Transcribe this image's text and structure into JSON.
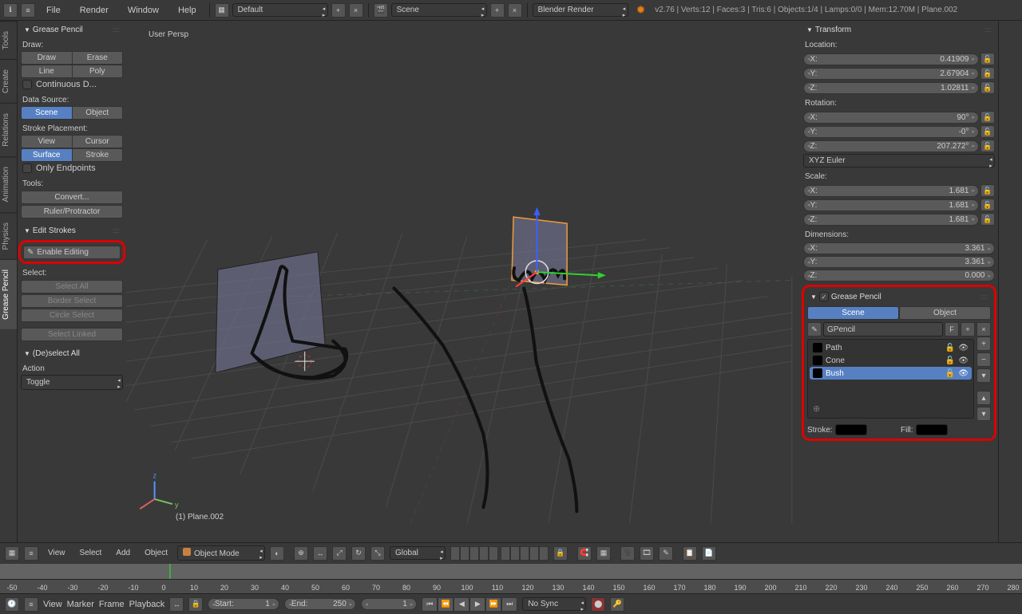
{
  "topbar": {
    "menus": [
      "File",
      "Render",
      "Window",
      "Help"
    ],
    "layout": "Default",
    "scene": "Scene",
    "engine": "Blender Render",
    "stats": "v2.76 | Verts:12 | Faces:3 | Tris:6 | Objects:1/4 | Lamps:0/0 | Mem:12.70M | Plane.002"
  },
  "sidetabs": [
    "Tools",
    "Create",
    "Relations",
    "Animation",
    "Physics",
    "Grease Pencil"
  ],
  "toolpanel": {
    "gp_header": "Grease Pencil",
    "draw_label": "Draw:",
    "draw": "Draw",
    "erase": "Erase",
    "line": "Line",
    "poly": "Poly",
    "continuous": "Continuous D...",
    "datasource_label": "Data Source:",
    "ds_scene": "Scene",
    "ds_object": "Object",
    "strokeplace_label": "Stroke Placement:",
    "sp_view": "View",
    "sp_cursor": "Cursor",
    "sp_surface": "Surface",
    "sp_stroke": "Stroke",
    "only_endpoints": "Only Endpoints",
    "tools_label": "Tools:",
    "convert": "Convert...",
    "ruler": "Ruler/Protractor",
    "edit_strokes_header": "Edit Strokes",
    "enable_editing": "Enable Editing",
    "select_label": "Select:",
    "select_all": "Select All",
    "border_select": "Border Select",
    "circle_select": "Circle Select",
    "select_linked": "Select Linked",
    "deselect_header": "(De)select All",
    "action_label": "Action",
    "toggle": "Toggle"
  },
  "viewport": {
    "persp": "User Persp",
    "obj_label": "(1) Plane.002"
  },
  "props": {
    "transform_header": "Transform",
    "location_label": "Location:",
    "loc": {
      "x": "0.41909",
      "y": "2.67904",
      "z": "1.02811"
    },
    "rotation_label": "Rotation:",
    "rot": {
      "x": "90°",
      "y": "-0°",
      "z": "207.272°"
    },
    "rot_mode": "XYZ Euler",
    "scale_label": "Scale:",
    "scale": {
      "x": "1.681",
      "y": "1.681",
      "z": "1.681"
    },
    "dim_label": "Dimensions:",
    "dim": {
      "x": "3.361",
      "y": "3.361",
      "z": "0.000"
    },
    "gp_header": "Grease Pencil",
    "gp_scene": "Scene",
    "gp_object": "Object",
    "gp_name": "GPencil",
    "gp_layers": [
      "Path",
      "Cone",
      "Bush"
    ],
    "stroke_label": "Stroke:",
    "fill_label": "Fill:"
  },
  "viewheader": {
    "view": "View",
    "select": "Select",
    "add": "Add",
    "object": "Object",
    "mode": "Object Mode",
    "global": "Global"
  },
  "ruler_ticks": [
    "-50",
    "-40",
    "-30",
    "-20",
    "-10",
    "0",
    "10",
    "20",
    "30",
    "40",
    "50",
    "60",
    "70",
    "80",
    "90",
    "100",
    "110",
    "120",
    "130",
    "140",
    "150",
    "160",
    "170",
    "180",
    "190",
    "200",
    "210",
    "220",
    "230",
    "240",
    "250",
    "260",
    "270",
    "280"
  ],
  "timeline_header": {
    "view": "View",
    "marker": "Marker",
    "frame": "Frame",
    "playback": "Playback",
    "start_label": "Start:",
    "start_val": "1",
    "end_label": "End:",
    "end_val": "250",
    "cur_val": "1",
    "nosync": "No Sync"
  }
}
